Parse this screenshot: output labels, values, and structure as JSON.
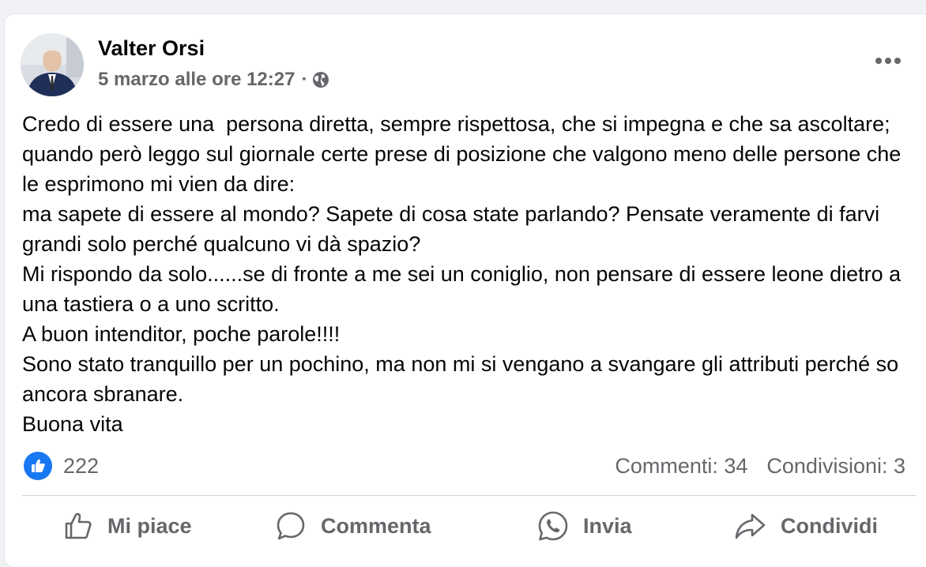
{
  "post": {
    "author": "Valter Orsi",
    "timestamp": "5 marzo alle ore 12:27",
    "separator": "·",
    "privacy_icon": "globe-icon",
    "more_icon": "more-horizontal-icon",
    "body": [
      "Credo di essere una  persona diretta, sempre rispettosa, che si impegna e che sa ascoltare; quando però leggo sul giornale certe prese di posizione che valgono meno delle persone che le esprimono mi vien da dire:",
      "ma sapete di essere al mondo? Sapete di cosa state parlando? Pensate veramente di farvi grandi solo perché qualcuno vi dà spazio?",
      "Mi rispondo da solo......se di fronte a me sei un coniglio, non pensare di essere leone dietro a una tastiera o a uno scritto.",
      "A buon intenditor, poche parole!!!!",
      "Sono stato tranquillo per un pochino, ma non mi si vengano a svangare gli attributi perché so ancora sbranare.",
      "Buona vita"
    ]
  },
  "stats": {
    "reaction_icon": "like-icon",
    "reactions": "222",
    "comments": "Commenti: 34",
    "shares": "Condivisioni: 3"
  },
  "actions": {
    "like": "Mi piace",
    "comment": "Commenta",
    "send": "Invia",
    "share": "Condividi"
  },
  "colors": {
    "accent": "#1877f2",
    "secondary_text": "#65676b",
    "primary_text": "#050505",
    "background": "#f0f2f5"
  }
}
